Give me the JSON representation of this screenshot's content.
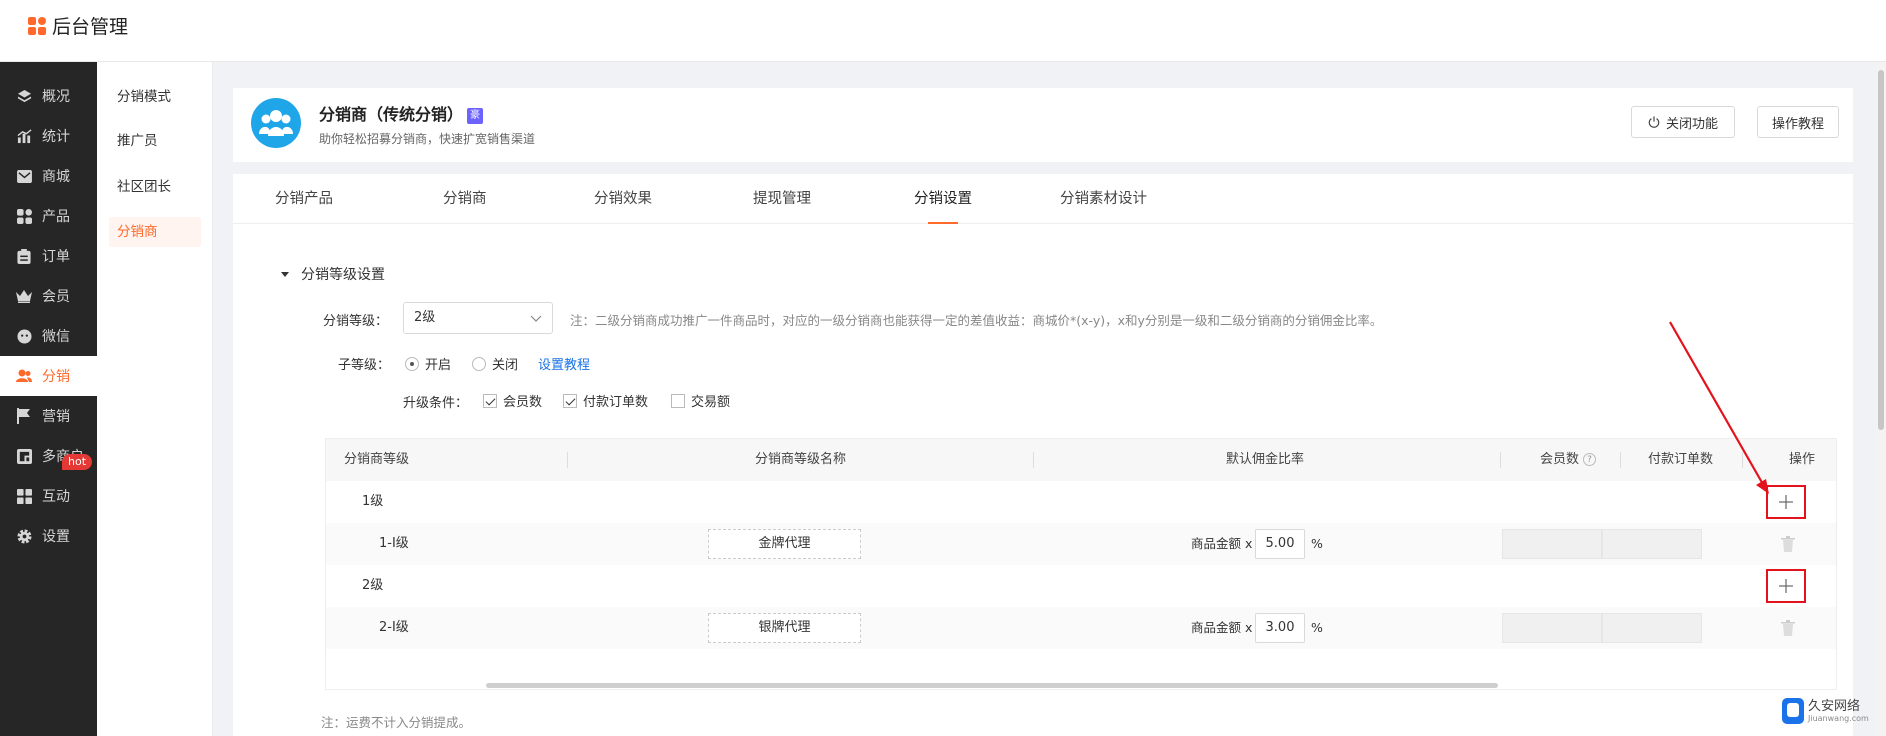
{
  "app": {
    "title": "后台管理"
  },
  "sidebar": {
    "items": [
      {
        "label": "概况",
        "icon": "layers-icon"
      },
      {
        "label": "统计",
        "icon": "chart-icon"
      },
      {
        "label": "商城",
        "icon": "mail-icon"
      },
      {
        "label": "产品",
        "icon": "grid-icon"
      },
      {
        "label": "订单",
        "icon": "clipboard-icon"
      },
      {
        "label": "会员",
        "icon": "crown-icon"
      },
      {
        "label": "微信",
        "icon": "wechat-icon"
      },
      {
        "label": "分销",
        "icon": "users-icon",
        "active": true
      },
      {
        "label": "营销",
        "icon": "flag-icon"
      },
      {
        "label": "多商户",
        "icon": "store-icon"
      },
      {
        "label": "互动",
        "icon": "apps-icon"
      },
      {
        "label": "设置",
        "icon": "gear-icon"
      }
    ],
    "hot_badge": "hot"
  },
  "subsidebar": {
    "items": [
      {
        "label": "分销模式"
      },
      {
        "label": "推广员"
      },
      {
        "label": "社区团长"
      },
      {
        "label": "分销商",
        "active": true
      }
    ]
  },
  "header": {
    "title": "分销商（传统分销）",
    "badge": "豪",
    "subtitle": "助你轻松招募分销商，快速扩宽销售渠道",
    "close_btn": "关闭功能",
    "tutorial_btn": "操作教程"
  },
  "tabs": [
    {
      "label": "分销产品"
    },
    {
      "label": "分销商"
    },
    {
      "label": "分销效果"
    },
    {
      "label": "提现管理"
    },
    {
      "label": "分销设置",
      "active": true
    },
    {
      "label": "分销素材设计"
    }
  ],
  "settings": {
    "section_title": "分销等级设置",
    "level_label": "分销等级：",
    "level_value": "2级",
    "level_note": "注：二级分销商成功推广一件商品时，对应的一级分销商也能获得一定的差值收益：商城价*(x-y)，x和y分别是一级和二级分销商的分销佣金比率。",
    "sublevel_label": "子等级：",
    "sublevel_on": "开启",
    "sublevel_off": "关闭",
    "sublevel_link": "设置教程",
    "upgrade_label": "升级条件：",
    "upgrade_options": [
      {
        "label": "会员数",
        "checked": true
      },
      {
        "label": "付款订单数",
        "checked": true
      },
      {
        "label": "交易额",
        "checked": false
      }
    ]
  },
  "table": {
    "headers": {
      "level": "分销商等级",
      "name": "分销商等级名称",
      "rate": "默认佣金比率",
      "members": "会员数",
      "orders": "付款订单数",
      "action": "操作"
    },
    "help_icon": "?",
    "rows": [
      {
        "type": "group",
        "level": "1级"
      },
      {
        "type": "sub",
        "level": "1-I级",
        "name": "金牌代理",
        "rate_label": "商品金额 x",
        "rate": "5.00",
        "unit": "%"
      },
      {
        "type": "group",
        "level": "2级"
      },
      {
        "type": "sub",
        "level": "2-I级",
        "name": "银牌代理",
        "rate_label": "商品金额 x",
        "rate": "3.00",
        "unit": "%"
      }
    ]
  },
  "footer_note": "注：运费不计入分销提成。",
  "watermark": {
    "title": "久安网络",
    "sub": "Jiuanwang.com"
  },
  "colors": {
    "accent": "#ff6a2c",
    "sidebar_bg": "#262626",
    "annotation": "#e3121c",
    "link": "#1a73e8"
  }
}
